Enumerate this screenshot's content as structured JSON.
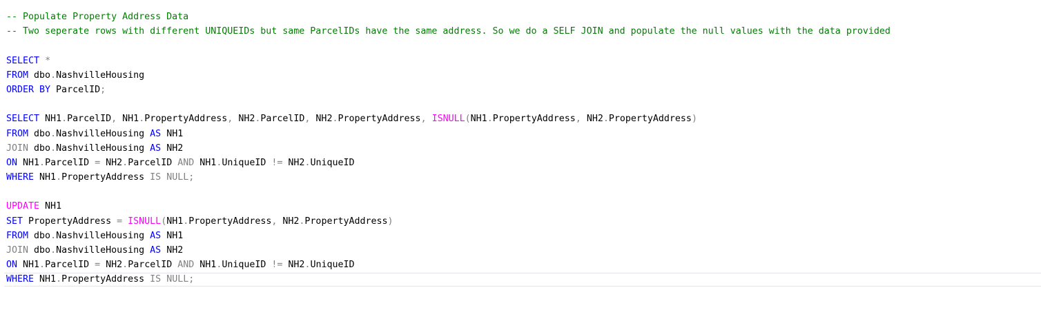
{
  "editor": {
    "lines": [
      [
        {
          "t": "-- Populate Property Address Data",
          "c": "c"
        }
      ],
      [
        {
          "t": "-- Two seperate rows with different UNIQUEIDs but same ParcelIDs have the same address. So we do a SELF JOIN and populate the null values with the data provided",
          "c": "c"
        }
      ],
      [],
      [
        {
          "t": "SELECT",
          "c": "k"
        },
        {
          "t": " ",
          "c": "t"
        },
        {
          "t": "*",
          "c": "g"
        }
      ],
      [
        {
          "t": "FROM",
          "c": "k"
        },
        {
          "t": " dbo",
          "c": "t"
        },
        {
          "t": ".",
          "c": "g"
        },
        {
          "t": "NashvilleHousing",
          "c": "t"
        }
      ],
      [
        {
          "t": "ORDER BY",
          "c": "k"
        },
        {
          "t": " ParcelID",
          "c": "t"
        },
        {
          "t": ";",
          "c": "g"
        }
      ],
      [],
      [
        {
          "t": "SELECT",
          "c": "k"
        },
        {
          "t": " NH1",
          "c": "t"
        },
        {
          "t": ".",
          "c": "g"
        },
        {
          "t": "ParcelID",
          "c": "t"
        },
        {
          "t": ",",
          "c": "g"
        },
        {
          "t": " NH1",
          "c": "t"
        },
        {
          "t": ".",
          "c": "g"
        },
        {
          "t": "PropertyAddress",
          "c": "t"
        },
        {
          "t": ",",
          "c": "g"
        },
        {
          "t": " NH2",
          "c": "t"
        },
        {
          "t": ".",
          "c": "g"
        },
        {
          "t": "ParcelID",
          "c": "t"
        },
        {
          "t": ",",
          "c": "g"
        },
        {
          "t": " NH2",
          "c": "t"
        },
        {
          "t": ".",
          "c": "g"
        },
        {
          "t": "PropertyAddress",
          "c": "t"
        },
        {
          "t": ",",
          "c": "g"
        },
        {
          "t": " ",
          "c": "t"
        },
        {
          "t": "ISNULL",
          "c": "f"
        },
        {
          "t": "(",
          "c": "g"
        },
        {
          "t": "NH1",
          "c": "t"
        },
        {
          "t": ".",
          "c": "g"
        },
        {
          "t": "PropertyAddress",
          "c": "t"
        },
        {
          "t": ",",
          "c": "g"
        },
        {
          "t": " NH2",
          "c": "t"
        },
        {
          "t": ".",
          "c": "g"
        },
        {
          "t": "PropertyAddress",
          "c": "t"
        },
        {
          "t": ")",
          "c": "g"
        }
      ],
      [
        {
          "t": "FROM",
          "c": "k"
        },
        {
          "t": " dbo",
          "c": "t"
        },
        {
          "t": ".",
          "c": "g"
        },
        {
          "t": "NashvilleHousing ",
          "c": "t"
        },
        {
          "t": "AS",
          "c": "k"
        },
        {
          "t": " NH1",
          "c": "t"
        }
      ],
      [
        {
          "t": "JOIN",
          "c": "g"
        },
        {
          "t": " dbo",
          "c": "t"
        },
        {
          "t": ".",
          "c": "g"
        },
        {
          "t": "NashvilleHousing ",
          "c": "t"
        },
        {
          "t": "AS",
          "c": "k"
        },
        {
          "t": " NH2",
          "c": "t"
        }
      ],
      [
        {
          "t": "ON",
          "c": "k"
        },
        {
          "t": " NH1",
          "c": "t"
        },
        {
          "t": ".",
          "c": "g"
        },
        {
          "t": "ParcelID ",
          "c": "t"
        },
        {
          "t": "=",
          "c": "g"
        },
        {
          "t": " NH2",
          "c": "t"
        },
        {
          "t": ".",
          "c": "g"
        },
        {
          "t": "ParcelID ",
          "c": "t"
        },
        {
          "t": "AND",
          "c": "g"
        },
        {
          "t": " NH1",
          "c": "t"
        },
        {
          "t": ".",
          "c": "g"
        },
        {
          "t": "UniqueID ",
          "c": "t"
        },
        {
          "t": "!=",
          "c": "g"
        },
        {
          "t": " NH2",
          "c": "t"
        },
        {
          "t": ".",
          "c": "g"
        },
        {
          "t": "UniqueID",
          "c": "t"
        }
      ],
      [
        {
          "t": "WHERE",
          "c": "k"
        },
        {
          "t": " NH1",
          "c": "t"
        },
        {
          "t": ".",
          "c": "g"
        },
        {
          "t": "PropertyAddress ",
          "c": "t"
        },
        {
          "t": "IS NULL",
          "c": "g"
        },
        {
          "t": ";",
          "c": "g"
        }
      ],
      [],
      [
        {
          "t": "UPDATE",
          "c": "f"
        },
        {
          "t": " NH1",
          "c": "t"
        }
      ],
      [
        {
          "t": "SET",
          "c": "k"
        },
        {
          "t": " PropertyAddress ",
          "c": "t"
        },
        {
          "t": "=",
          "c": "g"
        },
        {
          "t": " ",
          "c": "t"
        },
        {
          "t": "ISNULL",
          "c": "f"
        },
        {
          "t": "(",
          "c": "g"
        },
        {
          "t": "NH1",
          "c": "t"
        },
        {
          "t": ".",
          "c": "g"
        },
        {
          "t": "PropertyAddress",
          "c": "t"
        },
        {
          "t": ",",
          "c": "g"
        },
        {
          "t": " NH2",
          "c": "t"
        },
        {
          "t": ".",
          "c": "g"
        },
        {
          "t": "PropertyAddress",
          "c": "t"
        },
        {
          "t": ")",
          "c": "g"
        }
      ],
      [
        {
          "t": "FROM",
          "c": "k"
        },
        {
          "t": " dbo",
          "c": "t"
        },
        {
          "t": ".",
          "c": "g"
        },
        {
          "t": "NashvilleHousing ",
          "c": "t"
        },
        {
          "t": "AS",
          "c": "k"
        },
        {
          "t": " NH1",
          "c": "t"
        }
      ],
      [
        {
          "t": "JOIN",
          "c": "g"
        },
        {
          "t": " dbo",
          "c": "t"
        },
        {
          "t": ".",
          "c": "g"
        },
        {
          "t": "NashvilleHousing ",
          "c": "t"
        },
        {
          "t": "AS",
          "c": "k"
        },
        {
          "t": " NH2",
          "c": "t"
        }
      ],
      [
        {
          "t": "ON",
          "c": "k"
        },
        {
          "t": " NH1",
          "c": "t"
        },
        {
          "t": ".",
          "c": "g"
        },
        {
          "t": "ParcelID ",
          "c": "t"
        },
        {
          "t": "=",
          "c": "g"
        },
        {
          "t": " NH2",
          "c": "t"
        },
        {
          "t": ".",
          "c": "g"
        },
        {
          "t": "ParcelID ",
          "c": "t"
        },
        {
          "t": "AND",
          "c": "g"
        },
        {
          "t": " NH1",
          "c": "t"
        },
        {
          "t": ".",
          "c": "g"
        },
        {
          "t": "UniqueID ",
          "c": "t"
        },
        {
          "t": "!=",
          "c": "g"
        },
        {
          "t": " NH2",
          "c": "t"
        },
        {
          "t": ".",
          "c": "g"
        },
        {
          "t": "UniqueID",
          "c": "t"
        }
      ],
      [
        {
          "t": "WHERE",
          "c": "k"
        },
        {
          "t": " NH1",
          "c": "t"
        },
        {
          "t": ".",
          "c": "g"
        },
        {
          "t": "PropertyAddress ",
          "c": "t"
        },
        {
          "t": "IS NULL",
          "c": "g"
        },
        {
          "t": ";",
          "c": "g"
        }
      ]
    ]
  },
  "colors": {
    "comment": "#008000",
    "keyword": "#0000ff",
    "function": "#ff00ff",
    "operator": "#808080",
    "text": "#000000",
    "current_line_border": "#e4e4ec",
    "background": "#ffffff"
  }
}
